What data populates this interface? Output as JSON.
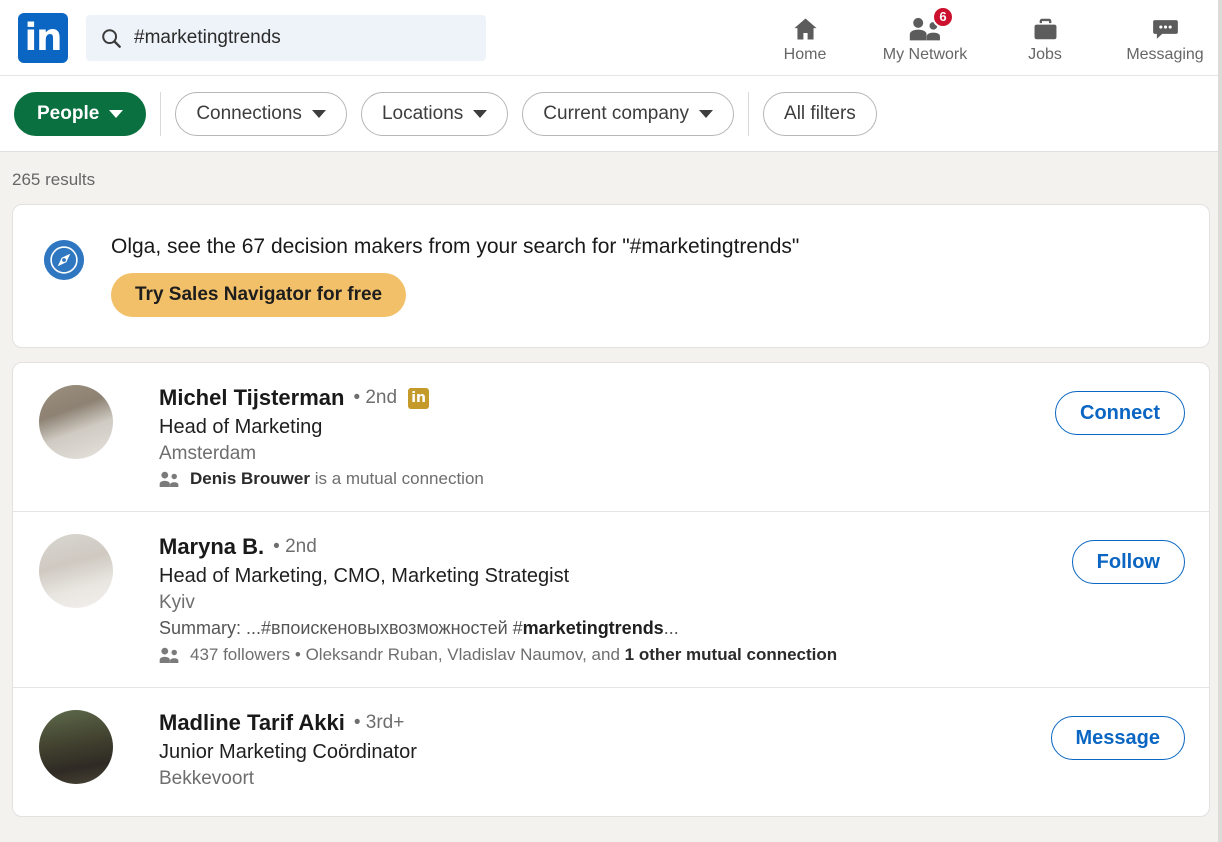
{
  "nav": {
    "logo_text": "in",
    "search": {
      "value": "#marketingtrends",
      "placeholder": "Search",
      "icon": "search-icon"
    },
    "items": [
      {
        "label": "Home",
        "icon": "home-icon",
        "badge": null
      },
      {
        "label": "My Network",
        "icon": "my-network-icon",
        "badge": "6"
      },
      {
        "label": "Jobs",
        "icon": "jobs-briefcase-icon",
        "badge": null
      },
      {
        "label": "Messaging",
        "icon": "messaging-icon",
        "badge": null
      }
    ]
  },
  "filters": {
    "primary": {
      "label": "People",
      "icon": "chevron-down-icon"
    },
    "pills": [
      {
        "label": "Connections",
        "has_caret": true
      },
      {
        "label": "Locations",
        "has_caret": true
      },
      {
        "label": "Current company",
        "has_caret": true
      }
    ],
    "all_filters_label": "All filters"
  },
  "results_count": "265 results",
  "promo": {
    "icon": "sales-navigator-compass-icon",
    "title": "Olga, see the 67 decision makers from your search for \"#marketingtrends\"",
    "button_label": "Try Sales Navigator for free"
  },
  "results": [
    {
      "name": "Michel Tijsterman",
      "degree": "• 2nd",
      "premium_badge": "in",
      "title": "Head of Marketing",
      "location": "Amsterdam",
      "summary": null,
      "summary_prefix": null,
      "summary_highlight": null,
      "summary_suffix": null,
      "mutual_prefix": "",
      "mutual_bold": "Denis Brouwer",
      "mutual_suffix": " is a mutual connection",
      "action_label": "Connect",
      "avatar": "avatar-michel-tijsterman"
    },
    {
      "name": "Maryna B.",
      "degree": "• 2nd",
      "premium_badge": null,
      "title": "Head of Marketing, CMO, Marketing Strategist",
      "location": "Kyiv",
      "summary_prefix": "Summary: ...#впоискеновыхвозможностей #",
      "summary_highlight": "marketingtrends",
      "summary_suffix": "...",
      "mutual_prefix": "437 followers • Oleksandr Ruban, Vladislav Naumov, and ",
      "mutual_bold": "1 other mutual connection",
      "mutual_suffix": "",
      "action_label": "Follow",
      "avatar": "avatar-maryna-b"
    },
    {
      "name": "Madline Tarif Akki",
      "degree": "• 3rd+",
      "premium_badge": null,
      "title": "Junior Marketing Coördinator",
      "location": "Bekkevoort",
      "summary_prefix": null,
      "summary_highlight": null,
      "summary_suffix": null,
      "mutual_prefix": null,
      "mutual_bold": null,
      "mutual_suffix": null,
      "action_label": "Message",
      "avatar": "avatar-madline-tarif-akki"
    }
  ],
  "colors": {
    "brand_blue": "#0a66c2",
    "people_green": "#0a7040",
    "promo_amber": "#f2c069",
    "badge_red": "#cb112d",
    "premium_gold": "#c49a2b",
    "page_bg": "#f3f2ef"
  }
}
